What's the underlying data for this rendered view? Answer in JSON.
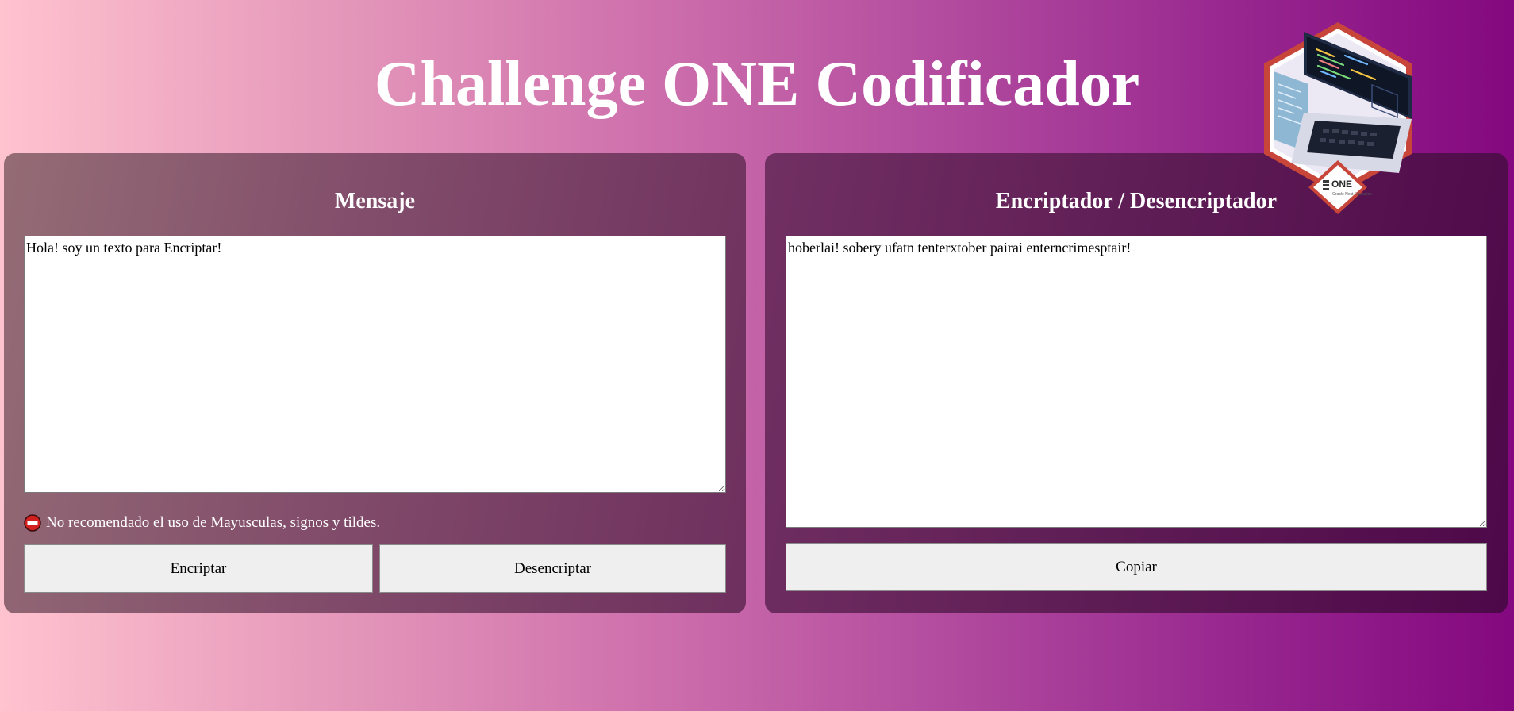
{
  "header": {
    "title": "Challenge ONE Codificador"
  },
  "input_panel": {
    "heading": "Mensaje",
    "textarea_value": "Hola! soy un texto para Encriptar!",
    "warning_text": "No recomendado el uso de Mayusculas, signos y tildes.",
    "encrypt_label": "Encriptar",
    "decrypt_label": "Desencriptar"
  },
  "output_panel": {
    "heading": "Encriptador / Desencriptador",
    "textarea_value": "hoberlai! sobery ufatn tenterxtober pairai enterncrimesptair!",
    "copy_label": "Copiar"
  },
  "logo": {
    "icon": "one-laptop-logo-icon",
    "text": "ONE",
    "subtext": "Oracle Next Education"
  },
  "icons": {
    "warning": "no-entry-icon"
  },
  "colors": {
    "accent_purple": "#84087f",
    "light_pink": "#ffc2cf",
    "button_bg": "#efefef",
    "warning_red": "#d21f1f",
    "logo_red": "#c8453a"
  }
}
